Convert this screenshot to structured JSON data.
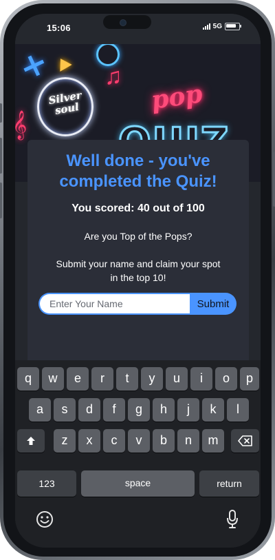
{
  "status_bar": {
    "time": "15:06",
    "network": "5G"
  },
  "banner": {
    "logo_text": "Silver soul",
    "word_pop": "pop",
    "word_quiz": "QUIZ"
  },
  "result": {
    "title": "Well done - you've completed the Quiz!",
    "score_text": "You scored: 40 out of 100",
    "question": "Are you Top of the Pops?",
    "prompt": "Submit your name and claim your spot in the top 10!",
    "name_placeholder": "Enter Your Name",
    "name_value": "",
    "submit_label": "Submit"
  },
  "keyboard": {
    "row1": [
      "q",
      "w",
      "e",
      "r",
      "t",
      "y",
      "u",
      "i",
      "o",
      "p"
    ],
    "row2": [
      "a",
      "s",
      "d",
      "f",
      "g",
      "h",
      "j",
      "k",
      "l"
    ],
    "row3": [
      "z",
      "x",
      "c",
      "v",
      "b",
      "n",
      "m"
    ],
    "numbers_label": "123",
    "space_label": "space",
    "return_label": "return",
    "shift_icon": "shift-icon",
    "backspace_icon": "backspace-icon",
    "emoji_icon": "emoji-icon",
    "mic_icon": "microphone-icon"
  },
  "colors": {
    "accent": "#4a94ff",
    "card_bg": "#2b2e38",
    "key_bg": "#5c5f65",
    "keyboard_bg": "#1f2125"
  }
}
